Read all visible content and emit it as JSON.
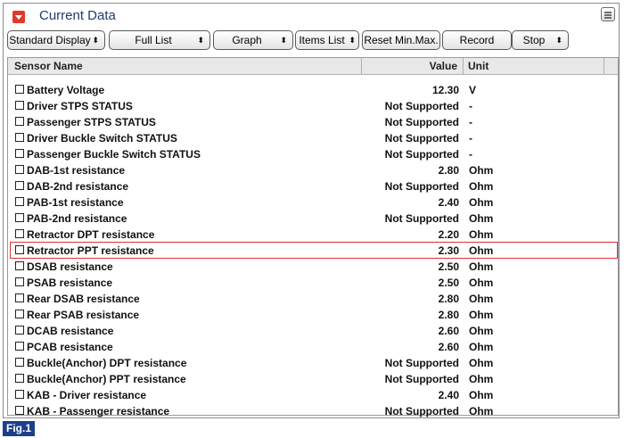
{
  "window": {
    "title": "Current Data",
    "title_icon": "collapse-arrow-icon",
    "menu_icon": "list-menu-icon",
    "accent_color": "#e0392b"
  },
  "toolbar": {
    "standard_display": "Standard Display",
    "full_list": "Full List",
    "graph": "Graph",
    "items_list": "Items List",
    "reset_min_max": "Reset Min.Max.",
    "record": "Record",
    "stop": "Stop",
    "spinner_glyph": "⬍"
  },
  "table": {
    "headers": {
      "name": "Sensor Name",
      "value": "Value",
      "unit": "Unit"
    },
    "selected_row_color": "#e03030",
    "rows": [
      {
        "name": "Battery Voltage",
        "value": "12.30",
        "unit": "V"
      },
      {
        "name": "Driver STPS STATUS",
        "value": "Not Supported",
        "unit": "-"
      },
      {
        "name": "Passenger STPS STATUS",
        "value": "Not Supported",
        "unit": "-"
      },
      {
        "name": "Driver Buckle Switch STATUS",
        "value": "Not Supported",
        "unit": "-"
      },
      {
        "name": "Passenger Buckle Switch STATUS",
        "value": "Not Supported",
        "unit": "-"
      },
      {
        "name": "DAB-1st resistance",
        "value": "2.80",
        "unit": "Ohm"
      },
      {
        "name": "DAB-2nd resistance",
        "value": "Not Supported",
        "unit": "Ohm"
      },
      {
        "name": "PAB-1st resistance",
        "value": "2.40",
        "unit": "Ohm"
      },
      {
        "name": "PAB-2nd resistance",
        "value": "Not Supported",
        "unit": "Ohm"
      },
      {
        "name": "Retractor DPT resistance",
        "value": "2.20",
        "unit": "Ohm"
      },
      {
        "name": "Retractor PPT resistance",
        "value": "2.30",
        "unit": "Ohm",
        "selected": true
      },
      {
        "name": "DSAB resistance",
        "value": "2.50",
        "unit": "Ohm"
      },
      {
        "name": "PSAB resistance",
        "value": "2.50",
        "unit": "Ohm"
      },
      {
        "name": "Rear DSAB resistance",
        "value": "2.80",
        "unit": "Ohm"
      },
      {
        "name": "Rear PSAB resistance",
        "value": "2.80",
        "unit": "Ohm"
      },
      {
        "name": "DCAB resistance",
        "value": "2.60",
        "unit": "Ohm"
      },
      {
        "name": "PCAB resistance",
        "value": "2.60",
        "unit": "Ohm"
      },
      {
        "name": "Buckle(Anchor) DPT resistance",
        "value": "Not Supported",
        "unit": "Ohm"
      },
      {
        "name": "Buckle(Anchor) PPT resistance",
        "value": "Not Supported",
        "unit": "Ohm"
      },
      {
        "name": "KAB - Driver resistance",
        "value": "2.40",
        "unit": "Ohm"
      },
      {
        "name": "KAB - Passenger resistance",
        "value": "Not Supported",
        "unit": "Ohm"
      }
    ]
  },
  "figure_label": "Fig.1"
}
